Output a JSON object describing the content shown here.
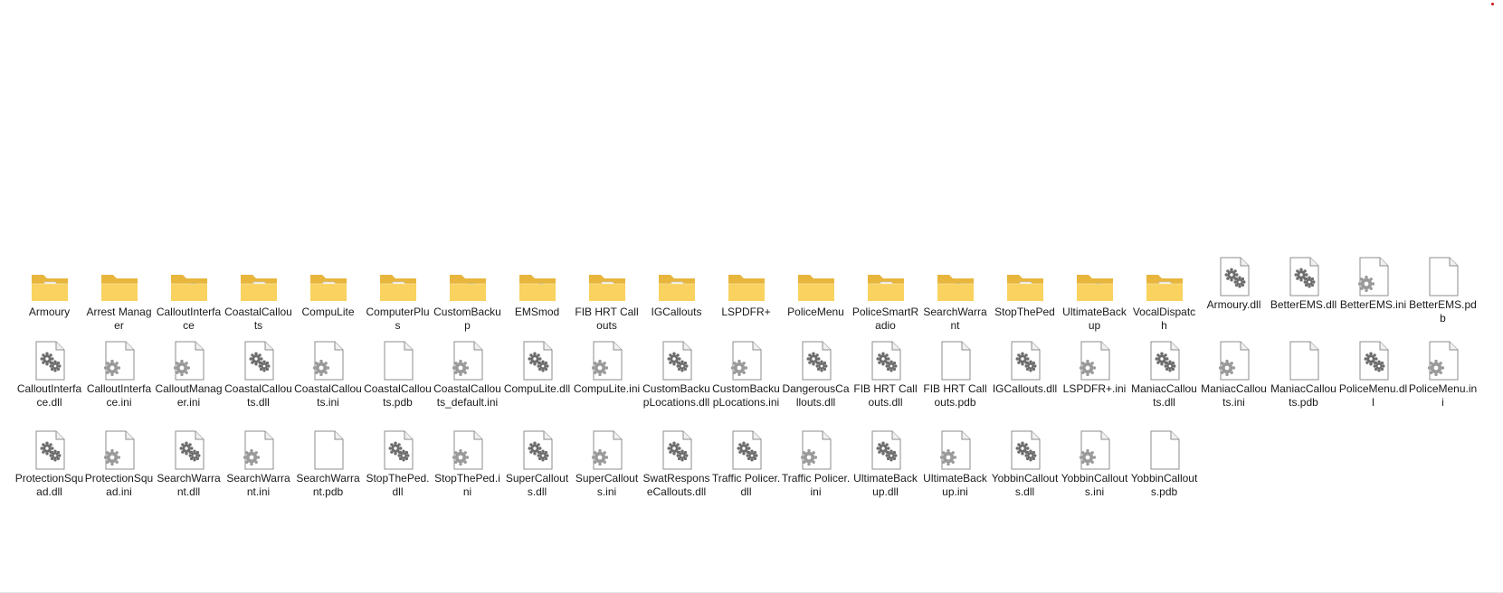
{
  "colors": {
    "background": "#ffffff",
    "text": "#1a1a1a",
    "folder_back": "#e8b53d",
    "folder_front": "#f9d25f",
    "accent_dot": "#d21414"
  },
  "rows": [
    [
      {
        "name": "Armoury",
        "type": "folder",
        "overlay": "document"
      },
      {
        "name": "Arrest Manager",
        "type": "folder",
        "overlay": "none"
      },
      {
        "name": "CalloutInterface",
        "type": "folder",
        "overlay": "edge"
      },
      {
        "name": "CoastalCallouts",
        "type": "folder",
        "overlay": "document"
      },
      {
        "name": "CompuLite",
        "type": "folder",
        "overlay": "settings-document"
      },
      {
        "name": "ComputerPlus",
        "type": "folder",
        "overlay": "document"
      },
      {
        "name": "CustomBackup",
        "type": "folder",
        "overlay": "edge"
      },
      {
        "name": "EMSmod",
        "type": "folder",
        "overlay": "edge"
      },
      {
        "name": "FIB HRT Callouts",
        "type": "folder",
        "overlay": "document"
      },
      {
        "name": "IGCallouts",
        "type": "folder",
        "overlay": "document"
      },
      {
        "name": "LSPDFR+",
        "type": "folder",
        "overlay": "none"
      },
      {
        "name": "PoliceMenu",
        "type": "folder",
        "overlay": "none"
      },
      {
        "name": "PoliceSmartRadio",
        "type": "folder",
        "overlay": "text-document"
      },
      {
        "name": "SearchWarrant",
        "type": "folder",
        "overlay": "edge"
      },
      {
        "name": "StopThePed",
        "type": "folder",
        "overlay": "document"
      },
      {
        "name": "UltimateBackup",
        "type": "folder",
        "overlay": "edge"
      },
      {
        "name": "VocalDispatch",
        "type": "folder",
        "overlay": "text-document"
      },
      {
        "name": "Armoury.dll",
        "type": "dll"
      },
      {
        "name": "BetterEMS.dll",
        "type": "dll"
      },
      {
        "name": "BetterEMS.ini",
        "type": "ini"
      },
      {
        "name": "BetterEMS.pdb",
        "type": "pdb"
      }
    ],
    [
      {
        "name": "CalloutInterface.dll",
        "type": "dll"
      },
      {
        "name": "CalloutInterface.ini",
        "type": "ini"
      },
      {
        "name": "CalloutManager.ini",
        "type": "ini"
      },
      {
        "name": "CoastalCallouts.dll",
        "type": "dll"
      },
      {
        "name": "CoastalCallouts.ini",
        "type": "ini"
      },
      {
        "name": "CoastalCallouts.pdb",
        "type": "pdb"
      },
      {
        "name": "CoastalCallouts_default.ini",
        "type": "ini"
      },
      {
        "name": "CompuLite.dll",
        "type": "dll"
      },
      {
        "name": "CompuLite.ini",
        "type": "ini"
      },
      {
        "name": "CustomBackupLocations.dll",
        "type": "dll"
      },
      {
        "name": "CustomBackupLocations.ini",
        "type": "ini"
      },
      {
        "name": "DangerousCallouts.dll",
        "type": "dll"
      },
      {
        "name": "FIB HRT Callouts.dll",
        "type": "dll"
      },
      {
        "name": "FIB HRT Callouts.pdb",
        "type": "pdb"
      },
      {
        "name": "IGCallouts.dll",
        "type": "dll"
      },
      {
        "name": "LSPDFR+.ini",
        "type": "ini"
      },
      {
        "name": "ManiacCallouts.dll",
        "type": "dll"
      },
      {
        "name": "ManiacCallouts.ini",
        "type": "ini"
      },
      {
        "name": "ManiacCallouts.pdb",
        "type": "pdb"
      },
      {
        "name": "PoliceMenu.dll",
        "type": "dll"
      },
      {
        "name": "PoliceMenu.ini",
        "type": "ini"
      }
    ],
    [
      {
        "name": "ProtectionSquad.dll",
        "type": "dll"
      },
      {
        "name": "ProtectionSquad.ini",
        "type": "ini"
      },
      {
        "name": "SearchWarrant.dll",
        "type": "dll"
      },
      {
        "name": "SearchWarrant.ini",
        "type": "ini"
      },
      {
        "name": "SearchWarrant.pdb",
        "type": "pdb"
      },
      {
        "name": "StopThePed.dll",
        "type": "dll"
      },
      {
        "name": "StopThePed.ini",
        "type": "ini"
      },
      {
        "name": "SuperCallouts.dll",
        "type": "dll"
      },
      {
        "name": "SuperCallouts.ini",
        "type": "ini"
      },
      {
        "name": "SwatResponseCallouts.dll",
        "type": "dll"
      },
      {
        "name": "Traffic Policer.dll",
        "type": "dll"
      },
      {
        "name": "Traffic Policer.ini",
        "type": "ini"
      },
      {
        "name": "UltimateBackup.dll",
        "type": "dll"
      },
      {
        "name": "UltimateBackup.ini",
        "type": "ini"
      },
      {
        "name": "YobbinCallouts.dll",
        "type": "dll"
      },
      {
        "name": "YobbinCallouts.ini",
        "type": "ini"
      },
      {
        "name": "YobbinCallouts.pdb",
        "type": "pdb"
      }
    ]
  ]
}
